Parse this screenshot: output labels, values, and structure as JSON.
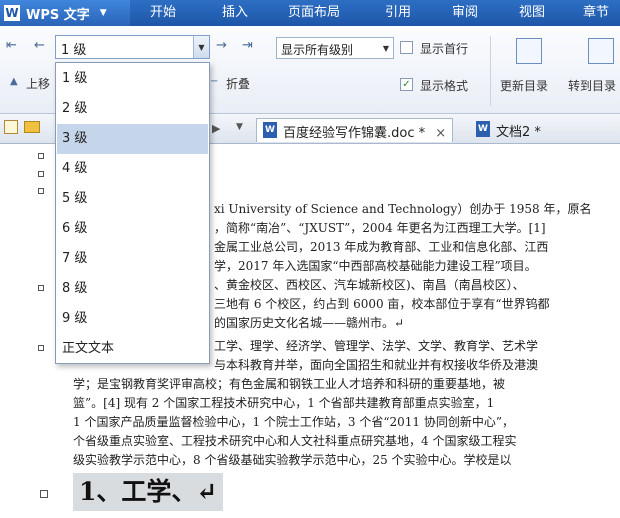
{
  "app": {
    "name": "WPS 文字",
    "logo": "W"
  },
  "menu": [
    "开始",
    "插入",
    "页面布局",
    "引用",
    "审阅",
    "视图",
    "章节"
  ],
  "ribbon": {
    "level_value": "1 级",
    "show_level_value": "显示所有级别",
    "show_first_line": "显示首行",
    "show_format": "显示格式",
    "show_format_checked": true,
    "promote": "上移",
    "collapse": "折叠",
    "update_toc": "更新目录",
    "goto_toc": "转到目录"
  },
  "tabs": [
    {
      "label": "百度经验写作锦囊.doc *",
      "close": "×",
      "active": true
    },
    {
      "label": "文档2 *",
      "close": "",
      "active": false
    }
  ],
  "dropdown": {
    "items": [
      "1 级",
      "2 级",
      "3 级",
      "4 级",
      "5 级",
      "6 级",
      "7 级",
      "8 级",
      "9 级",
      "正文文本"
    ],
    "selected_index": 2
  },
  "document": {
    "lines": [
      "xi University of Science and Technology）创办于 1958 年，原名",
      "，简称“南冶”、“JXUST”，2004 年更名为江西理工大学。[1]",
      "金属工业总公司，2013 年成为教育部、工业和信息化部、江西",
      "学，2017 年入选国家“中西部高校基础能力建设工程”项目。",
      "、黄金校区、西校区、汽车城新校区)、南昌（南昌校区）、",
      "三地有 6 个校区，约占到 6000 亩，校本部位于享有“世界钨都",
      "的国家历史文化名城——赣州市。↵",
      "工学、理学、经济学、管理学、法学、文学、教育学、艺术学",
      "与本科教育并举，面向全国招生和就业并有权接收华侨及港澳",
      "学；是宝钢教育奖评审高校；有色金属和钢铁工业人才培养和科研的重要基地，被",
      "篮”。[4]  现有 2 个国家工程技术研究中心，1 个省部共建教育部重点实验室，1",
      "1 个国家产品质量监督检验中心，1 个院士工作站，3 个省“2011 协同创新中心”，",
      "个省级重点实验室、工程技术研究中心和人文社科重点研究基地，4 个国家级工程实",
      "级实验教学示范中心，8 个省级基础实验教学示范中心，25 个实验中心。学校是以"
    ],
    "heading": "1、工学、↵"
  }
}
